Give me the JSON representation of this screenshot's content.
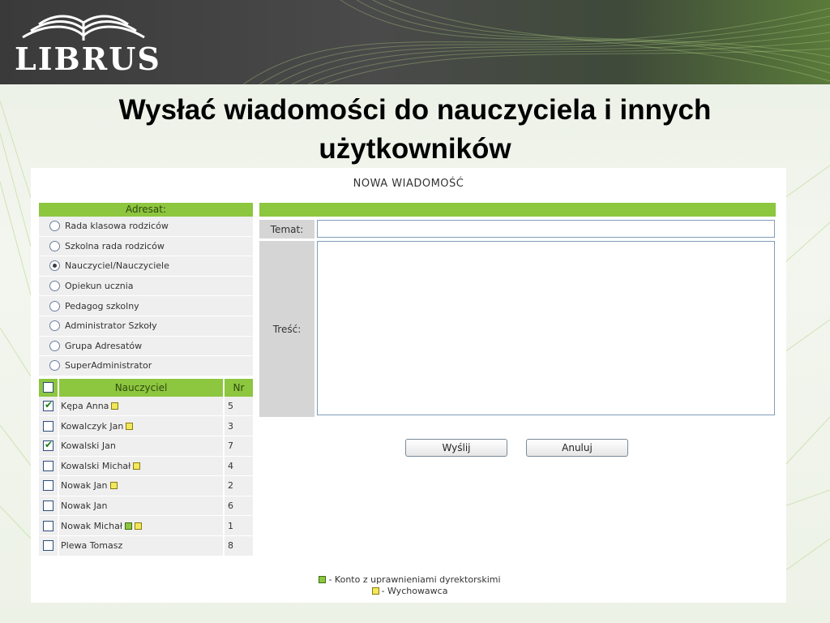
{
  "logo": {
    "text": "LIBRUS"
  },
  "slide_title": "Wysłać wiadomości do nauczyciela i innych użytkowników",
  "panel_title": "NOWA WIADOMOŚĆ",
  "recipient": {
    "header": "Adresat:",
    "options": [
      {
        "label": "Rada klasowa rodziców",
        "checked": false
      },
      {
        "label": "Szkolna rada rodziców",
        "checked": false
      },
      {
        "label": "Nauczyciel/Nauczyciele",
        "checked": true
      },
      {
        "label": "Opiekun ucznia",
        "checked": false
      },
      {
        "label": "Pedagog szkolny",
        "checked": false
      },
      {
        "label": "Administrator Szkoły",
        "checked": false
      },
      {
        "label": "Grupa Adresatów",
        "checked": false
      },
      {
        "label": "SuperAdministrator",
        "checked": false
      }
    ]
  },
  "teachers": {
    "col_name": "Nauczyciel",
    "col_nr": "Nr",
    "rows": [
      {
        "name": "Kępa Anna",
        "nr": "5",
        "checked": true,
        "badges": [
          "yellow"
        ]
      },
      {
        "name": "Kowalczyk Jan",
        "nr": "3",
        "checked": false,
        "badges": [
          "yellow"
        ]
      },
      {
        "name": "Kowalski Jan",
        "nr": "7",
        "checked": true,
        "badges": []
      },
      {
        "name": "Kowalski Michał",
        "nr": "4",
        "checked": false,
        "badges": [
          "yellow"
        ]
      },
      {
        "name": "Nowak Jan",
        "nr": "2",
        "checked": false,
        "badges": [
          "yellow"
        ]
      },
      {
        "name": "Nowak Jan",
        "nr": "6",
        "checked": false,
        "badges": []
      },
      {
        "name": "Nowak Michał",
        "nr": "1",
        "checked": false,
        "badges": [
          "green",
          "yellow"
        ]
      },
      {
        "name": "Plewa Tomasz",
        "nr": "8",
        "checked": false,
        "badges": []
      }
    ]
  },
  "form": {
    "subject_label": "Temat:",
    "subject_value": "",
    "body_label": "Treść:",
    "body_value": "",
    "send_label": "Wyślij",
    "cancel_label": "Anuluj"
  },
  "legend": {
    "director": "- Konto z uprawnieniami dyrektorskimi",
    "tutor": "- Wychowawca"
  },
  "colors": {
    "accent_green": "#8dc63f",
    "badge_yellow": "#f2e85a",
    "label_gray": "#d5d5d5",
    "row_gray": "#efefef"
  }
}
